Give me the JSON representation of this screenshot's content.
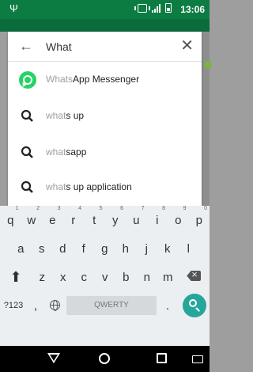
{
  "status_bar": {
    "usb_icon": "usb-icon",
    "time": "13:06",
    "color": "#0d7c43"
  },
  "search": {
    "query": "What",
    "back_icon": "arrow-left-icon",
    "back_glyph": "←",
    "clear_icon": "close-icon",
    "clear_glyph": "✕"
  },
  "suggestions": [
    {
      "icon": "whatsapp-icon",
      "prefix": "Whats",
      "rest": "App Messenger"
    },
    {
      "icon": "search-icon",
      "prefix": "what",
      "rest": "s up"
    },
    {
      "icon": "search-icon",
      "prefix": "what",
      "rest": "sapp"
    },
    {
      "icon": "search-icon",
      "prefix": "what",
      "rest": "s up application"
    }
  ],
  "keyboard": {
    "row1": [
      {
        "key": "q",
        "num": "1"
      },
      {
        "key": "w",
        "num": "2"
      },
      {
        "key": "e",
        "num": "3"
      },
      {
        "key": "r",
        "num": "4"
      },
      {
        "key": "t",
        "num": "5"
      },
      {
        "key": "y",
        "num": "6"
      },
      {
        "key": "u",
        "num": "7"
      },
      {
        "key": "i",
        "num": "8"
      },
      {
        "key": "o",
        "num": "9"
      },
      {
        "key": "p",
        "num": "0"
      }
    ],
    "row2": [
      "a",
      "s",
      "d",
      "f",
      "g",
      "h",
      "j",
      "k",
      "l"
    ],
    "row3": [
      "z",
      "x",
      "c",
      "v",
      "b",
      "n",
      "m"
    ],
    "shift_icon": "shift-icon",
    "shift_glyph": "⬆",
    "delete_icon": "backspace-icon",
    "symbols_label": "?123",
    "comma_label": ",",
    "globe_icon": "globe-icon",
    "space_label": "QWERTY",
    "period_label": ".",
    "go_icon": "search-icon",
    "go_color": "#26a69a"
  },
  "nav_bar": {
    "back_icon": "nav-back-icon",
    "home_icon": "nav-home-icon",
    "recents_icon": "nav-recents-icon",
    "keyboard_icon": "keyboard-switch-icon"
  }
}
